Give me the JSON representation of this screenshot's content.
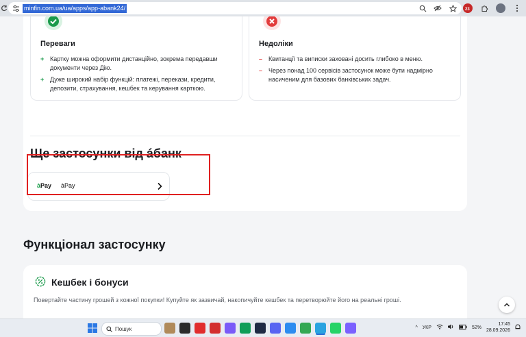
{
  "browser": {
    "url": "minfin.com.ua/ua/apps/app-abank24/"
  },
  "pros_cons": {
    "pros": {
      "title": "Переваги",
      "items": [
        "Картку можна оформити дистанційно, зокрема передавши документи через Дію.",
        "Дуже широкий набір функцій: платежі, перекази, кредити, депозити, страхування, кешбек та керування карткою."
      ]
    },
    "cons": {
      "title": "Недоліки",
      "items": [
        "Квитанції та виписки заховані досить глибоко в меню.",
        "Через понад 100 сервісів застосунок може бути надмірно насиченим для базових банківських задач."
      ]
    }
  },
  "more_apps": {
    "title": "Ще застосунки від áбанк",
    "app": {
      "logo_prefix": "à",
      "logo_main": "Pay",
      "name": "àPay"
    }
  },
  "features": {
    "title": "Функціонал застосунку",
    "cashback": {
      "title": "Кешбек і бонуси",
      "description": "Повертайте частину грошей з кожної покупки! Купуйте як зазвичай, накопичуйте кешбек та перетворюйте його на реальні гроші."
    }
  },
  "taskbar": {
    "search_placeholder": "Пошук",
    "language": "УКР",
    "battery": "52%",
    "time": "17:45",
    "date": "28.09.2026",
    "extension_badge": "23",
    "app_colors": [
      "#b08a5a",
      "#2b2b2b",
      "#e12d2d",
      "#d32f2f",
      "#7a5af8",
      "#0f9d58",
      "#1f2a44",
      "#5865f2",
      "#2d8cf0",
      "#34a853",
      "#2aa3e0",
      "#25d366",
      "#7b61ff"
    ]
  },
  "icons": {
    "pros": "check-icon",
    "cons": "close-icon",
    "chevron": "chevron-right-icon",
    "cashback": "percent-badge-icon",
    "scroll": "chevron-up-icon"
  },
  "colors": {
    "success": "#1a9a4b",
    "danger": "#e23c3c",
    "highlight": "#e02020",
    "link_select": "#3268d6"
  }
}
